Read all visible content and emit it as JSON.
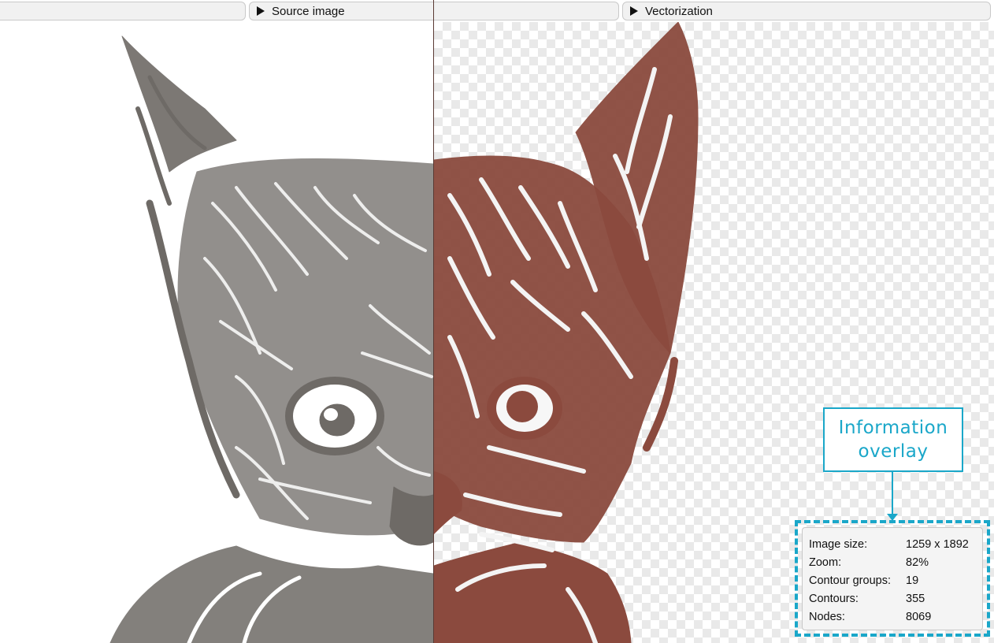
{
  "toolbar": {
    "source_image_label": "Source image",
    "vectorization_label": "Vectorization"
  },
  "icons": {
    "expand": "play-triangle-icon"
  },
  "callout": {
    "line1": "Information",
    "line2": "overlay"
  },
  "info_overlay": {
    "rows": [
      {
        "label": "Image size:",
        "value": "1259 x 1892"
      },
      {
        "label": "Zoom:",
        "value": "82%"
      },
      {
        "label": "Contour groups:",
        "value": "19"
      },
      {
        "label": "Contours:",
        "value": "355"
      },
      {
        "label": "Nodes:",
        "value": "8069"
      }
    ]
  },
  "colors": {
    "accent": "#1aa7c9",
    "vector_fill": "#8b4a3e",
    "source_ink": "#6e6a66"
  }
}
